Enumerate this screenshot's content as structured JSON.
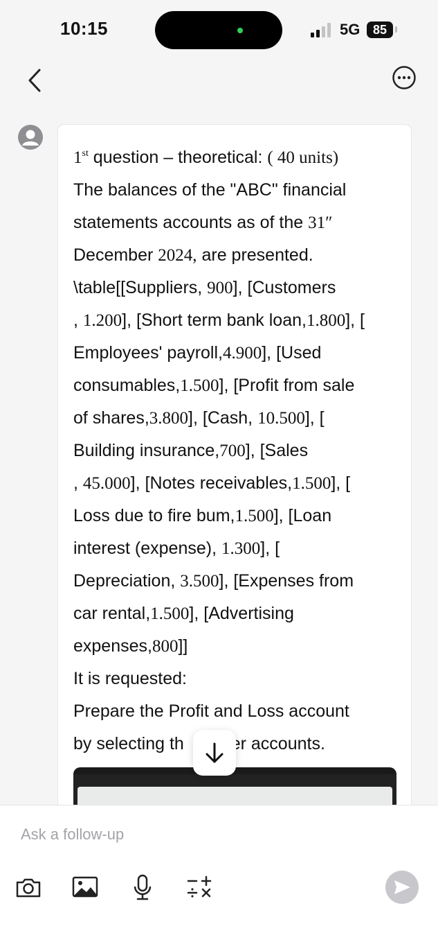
{
  "status_bar": {
    "time": "10:15",
    "network": "5G",
    "battery": "85",
    "island_indicator_color": "#2fd158"
  },
  "nav": {
    "back_icon": "chevron-left-icon",
    "more_icon": "ellipsis-circle-icon"
  },
  "message": {
    "avatar_icon": "user-icon",
    "lines": [
      "The balances of the \"ABC\" financial",
      "statements accounts as of the ",
      "December ",
      "\\table[[Suppliers, ",
      ", ",
      "Employees' payroll,",
      "consumables,",
      "of shares,",
      "Building insurance,",
      ", ",
      "Loss due to fire bum,",
      "interest (expense), ",
      "Depreciation, ",
      "car rental,",
      "expenses,",
      "It is requested:",
      "Prepare the Profit and Loss account",
      "by selecting th",
      "per accounts."
    ],
    "first_line": {
      "num": "1",
      "sup": "st",
      "text_a": " question ",
      "dash": "–",
      "text_b": " theoretical: ",
      "units": "( 40 units)"
    },
    "inline": {
      "date_day": "31″",
      "year_suffix": "2024,",
      "year_rest": " are presented.",
      "l4_num": "900",
      "l4_rest": "], [Customers",
      "l5_num": "1.200",
      "l5_mid": "], [Short term bank loan,",
      "l5_num2": "1.800",
      "l5_end": "], [",
      "l6_num": "4.900",
      "l6_end": "], [Used",
      "l7_num": "1.500",
      "l7_end": "], [Profit from sale",
      "l8_num": "3.800",
      "l8_mid": "], [Cash, ",
      "l8_num2": "10.500",
      "l8_end": "], [",
      "l9_num": "700",
      "l9_end": "], [Sales",
      "l10_num": "45.000",
      "l10_mid": "], [Notes receivables,",
      "l10_num2": "1.500",
      "l10_end": "], [",
      "l11_num": "1.500",
      "l11_end": "], [Loan",
      "l12_num": "1.300",
      "l12_end": "], [",
      "l13_num": "3.500",
      "l13_end": "], [Expenses from",
      "l14_num": "1.500",
      "l14_end": "], [Advertising",
      "l15_num": "800",
      "l15_end": "]]"
    }
  },
  "scroll_button": {
    "icon": "arrow-down-icon"
  },
  "composer": {
    "placeholder": "Ask a follow-up",
    "tools": [
      "camera-icon",
      "image-icon",
      "microphone-icon",
      "math-symbols-icon"
    ],
    "send_icon": "send-icon"
  }
}
